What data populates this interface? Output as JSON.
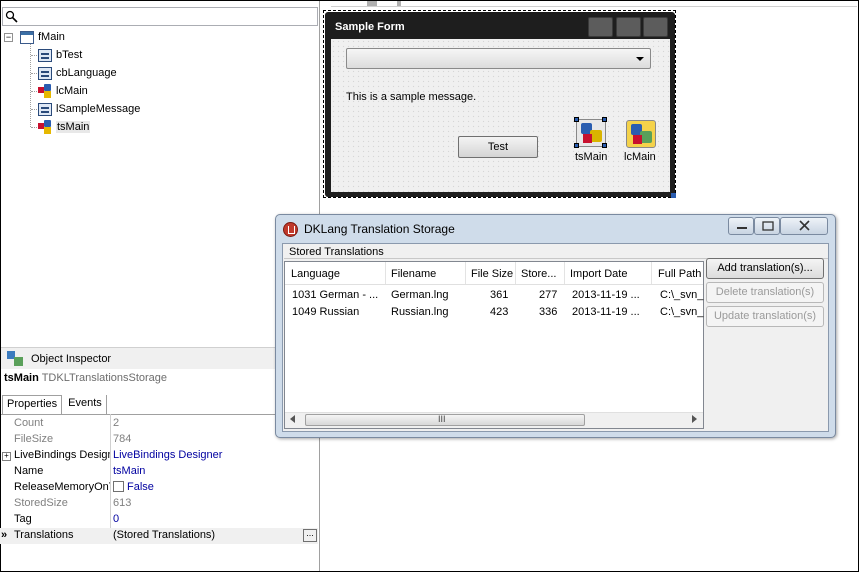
{
  "structure_tree": {
    "root": "fMain",
    "items": [
      {
        "label": "bTest",
        "icon": "button-component-icon"
      },
      {
        "label": "cbLanguage",
        "icon": "combobox-component-icon"
      },
      {
        "label": "lcMain",
        "icon": "language-controller-icon"
      },
      {
        "label": "lSampleMessage",
        "icon": "label-component-icon"
      },
      {
        "label": "tsMain",
        "icon": "translations-storage-icon"
      }
    ],
    "expander": "−"
  },
  "object_inspector": {
    "title": "Object Inspector",
    "component_name": "tsMain",
    "component_class": "TDKLTranslationsStorage",
    "tabs": [
      "Properties",
      "Events"
    ],
    "properties": [
      {
        "name": "Count",
        "value": "2",
        "readonly": true
      },
      {
        "name": "FileSize",
        "value": "784",
        "readonly": true
      },
      {
        "name": "LiveBindings Designer",
        "value": "LiveBindings Designer",
        "expandable": true
      },
      {
        "name": "Name",
        "value": "tsMain"
      },
      {
        "name": "ReleaseMemoryOnTranslate",
        "value": "False",
        "checkbox": true
      },
      {
        "name": "StoredSize",
        "value": "613",
        "readonly": true
      },
      {
        "name": "Tag",
        "value": "0"
      },
      {
        "name": "Translations",
        "value": "(Stored Translations)",
        "selected": true
      }
    ],
    "plus": "+",
    "selected_marker": "»",
    "ellipsis": "..."
  },
  "sample_form": {
    "title": "Sample Form",
    "message": "This is a sample message.",
    "test_button": "Test",
    "components": [
      "tsMain",
      "lcMain"
    ]
  },
  "dklang_window": {
    "title": "DKLang Translation Storage",
    "controls": {
      "minimize": "–",
      "maximize": "□",
      "close": "✕"
    },
    "group_title": "Stored Translations",
    "columns": [
      "Language",
      "Filename",
      "File Size",
      "Store...",
      "Import Date",
      "Full Path"
    ],
    "rows": [
      [
        "1031 German - ...",
        "German.lng",
        "361",
        "277",
        "2013-11-19 ...",
        "C:\\_svn_"
      ],
      [
        "1049 Russian",
        "Russian.lng",
        "423",
        "336",
        "2013-11-19 ...",
        "C:\\_svn_"
      ]
    ],
    "scroll_grip": "III",
    "buttons": {
      "add": "Add translation(s)...",
      "delete": "Delete translation(s)",
      "update": "Update translation(s)"
    }
  }
}
